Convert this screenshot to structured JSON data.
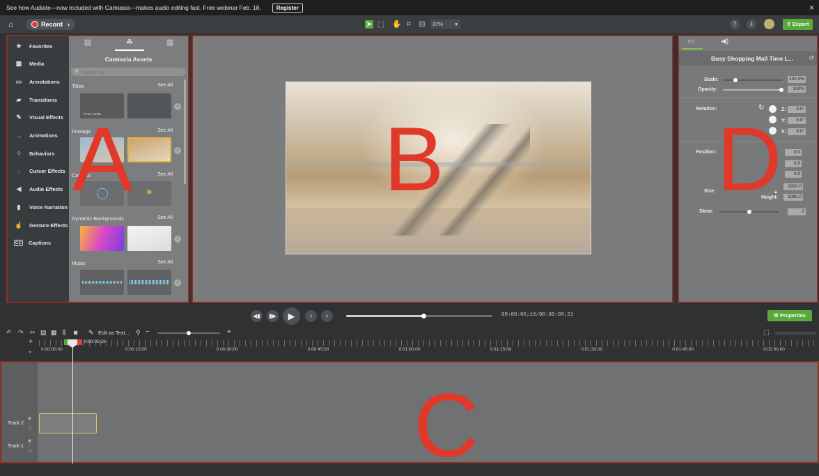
{
  "banner": {
    "message": "See how Audiate—now included with Camtasia—makes audio editing fast. Free webinar Feb. 18.",
    "register": "Register",
    "close": "×"
  },
  "toolbar": {
    "record": "Record",
    "zoom": "37%",
    "help": "?",
    "export": "Export"
  },
  "sidebar": {
    "items": [
      {
        "label": "Favorites",
        "icon": "★"
      },
      {
        "label": "Media",
        "icon": "▦"
      },
      {
        "label": "Annotations",
        "icon": "▭"
      },
      {
        "label": "Transitions",
        "icon": "▰"
      },
      {
        "label": "Visual Effects",
        "icon": "✎"
      },
      {
        "label": "Animations",
        "icon": "→"
      },
      {
        "label": "Behaviors",
        "icon": "⁘"
      },
      {
        "label": "Cursor Effects",
        "icon": "◌"
      },
      {
        "label": "Audio Effects",
        "icon": "◀"
      },
      {
        "label": "Voice Narration",
        "icon": "▮"
      },
      {
        "label": "Gesture Effects",
        "icon": "☝"
      },
      {
        "label": "Captions",
        "icon": "CC"
      }
    ]
  },
  "library": {
    "title": "Camtasia Assets",
    "search_placeholder": "Search All",
    "see_all": "See All",
    "sections": [
      "Titles",
      "Footage",
      "Callouts",
      "Dynamic Backgrounds",
      "Music"
    ],
    "title_thumb_text": "TITLE HERE"
  },
  "properties": {
    "title": "Busy Shopping Mall Time L...",
    "scale_label": "Scale:",
    "scale_value": "100.0%",
    "opacity_label": "Opacity:",
    "opacity_value": "100%",
    "rotation_label": "Rotation:",
    "rot_z": "0.0°",
    "rot_y": "0.0°",
    "rot_x": "0.0°",
    "position_label": "Position:",
    "pos_x": "0.0",
    "pos_y": "0.0",
    "pos_z": "0.0",
    "size_label": "Size:",
    "width_value": "1920.0",
    "height_label": "Height:",
    "height_value": "1080.0",
    "skew_label": "Skew:",
    "skew_value": "0",
    "axis_z": "Z:",
    "axis_y": "Y:",
    "axis_x": "X:"
  },
  "playback": {
    "timecode_current": "00:00:05;19",
    "timecode_total": "00:00:09;21",
    "properties_button": "Properties",
    "progress": 0.53
  },
  "timeline": {
    "edit_as_text": "Edit as Text...",
    "playhead": "0:00:05;19",
    "ticks": [
      "0:00:00;00",
      "0:00:15;00",
      "0:00:30;00",
      "0:00:45;00",
      "0:01:00;00",
      "0:01:15;00",
      "0:01:30;00",
      "0:01:45;00",
      "0:02:00;00"
    ],
    "tracks": [
      "Track 2",
      "Track 1"
    ]
  },
  "annotations": {
    "a": "A",
    "b": "B",
    "c": "C",
    "d": "D"
  }
}
